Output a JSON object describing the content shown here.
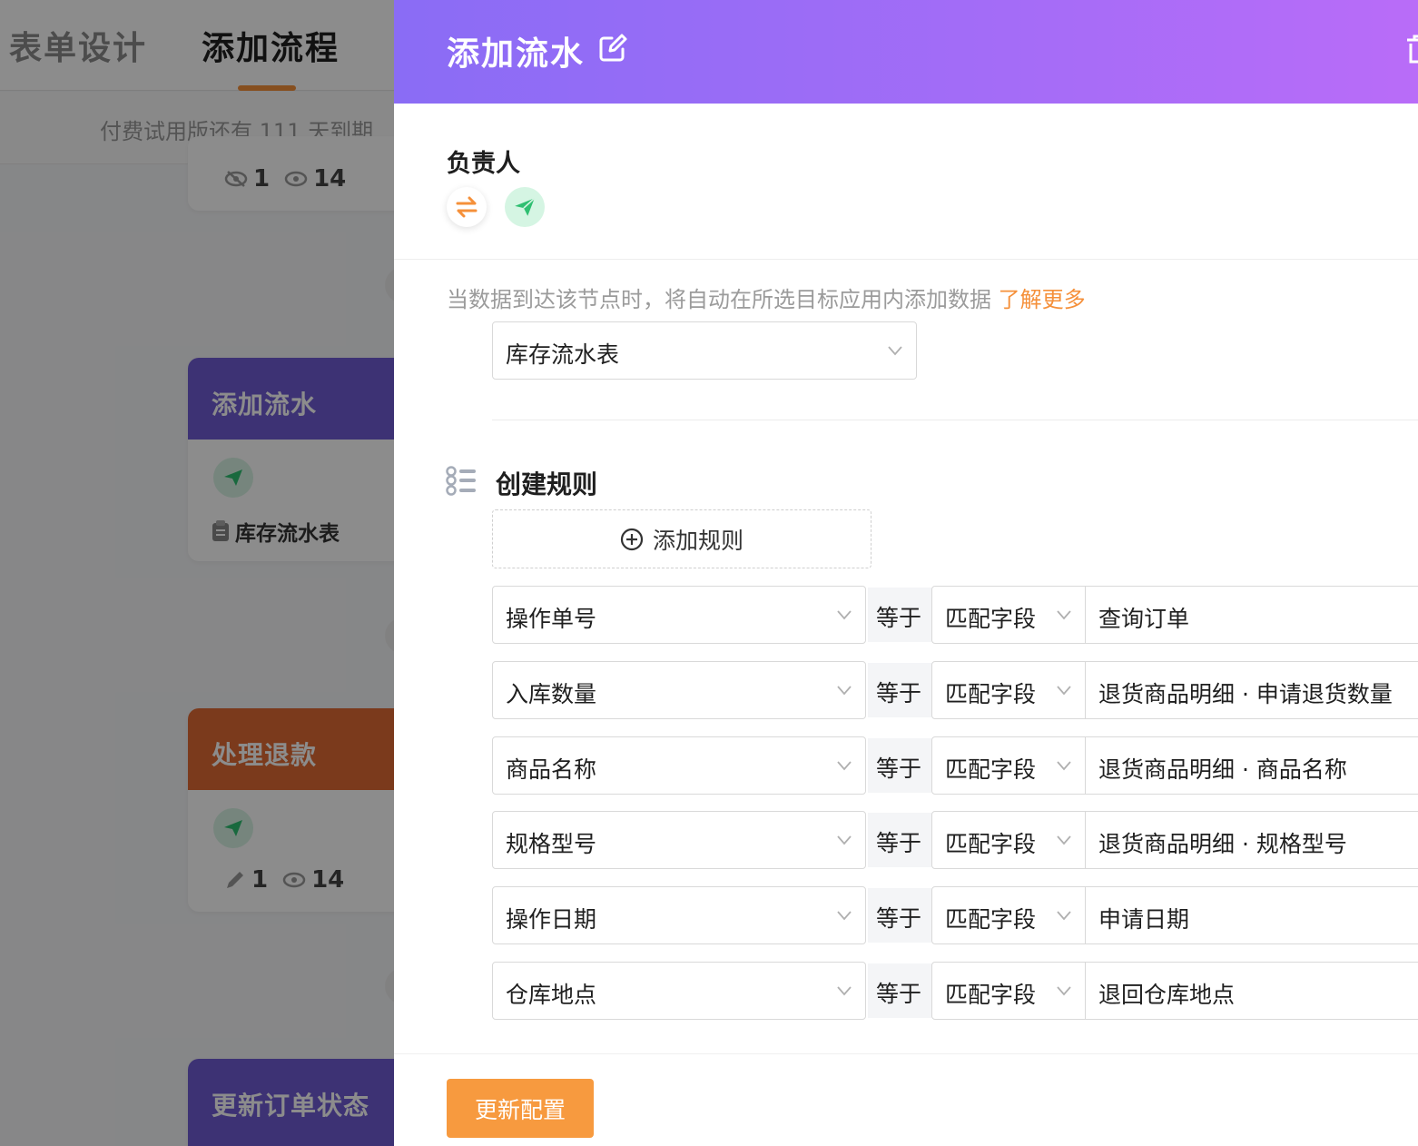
{
  "background": {
    "tabs": {
      "form_design": "表单设计",
      "add_flow": "添加流程"
    },
    "trial_notice": "付费试用版还有 111 天到期,",
    "cards": [
      {
        "title": "",
        "meta": {
          "hidden_count": "1",
          "view_count": "14"
        },
        "color": "#ffffff"
      },
      {
        "title": "添加流水",
        "target": "库存流水表",
        "color": "#6f5bd4"
      },
      {
        "title": "处理退款",
        "meta": {
          "edit_count": "1",
          "view_count": "14"
        },
        "color": "#e06a34"
      },
      {
        "title": "更新订单状态",
        "color": "#6f5bd4"
      }
    ]
  },
  "drawer": {
    "title": "添加流水",
    "owner_label": "负责人",
    "hint": "当数据到达该节点时，将自动在所选目标应用内添加数据",
    "hint_link": "了解更多",
    "target_app": "库存流水表",
    "rules_title": "创建规则",
    "add_rule_label": "添加规则",
    "rules": [
      {
        "field": "操作单号",
        "operator": "等于",
        "mode": "匹配字段",
        "value": "查询订单"
      },
      {
        "field": "入库数量",
        "operator": "等于",
        "mode": "匹配字段",
        "value": "退货商品明细 · 申请退货数量"
      },
      {
        "field": "商品名称",
        "operator": "等于",
        "mode": "匹配字段",
        "value": "退货商品明细 · 商品名称"
      },
      {
        "field": "规格型号",
        "operator": "等于",
        "mode": "匹配字段",
        "value": "退货商品明细 · 规格型号"
      },
      {
        "field": "操作日期",
        "operator": "等于",
        "mode": "匹配字段",
        "value": "申请日期"
      },
      {
        "field": "仓库地点",
        "operator": "等于",
        "mode": "匹配字段",
        "value": "退回仓库地点"
      }
    ],
    "update_button": "更新配置"
  },
  "colors": {
    "header_gradient_start": "#8a6cf5",
    "header_gradient_end": "#b96cf8",
    "accent_orange": "#f79a3f",
    "link_orange": "#f5903a",
    "send_green": "#2fbf71"
  },
  "icons": {
    "edit": "edit-icon",
    "trash": "trash-icon",
    "swap": "swap-icon",
    "send": "send-icon",
    "rules": "rules-list-icon",
    "add": "plus-circle-icon",
    "chevron": "chevron-down-icon"
  }
}
